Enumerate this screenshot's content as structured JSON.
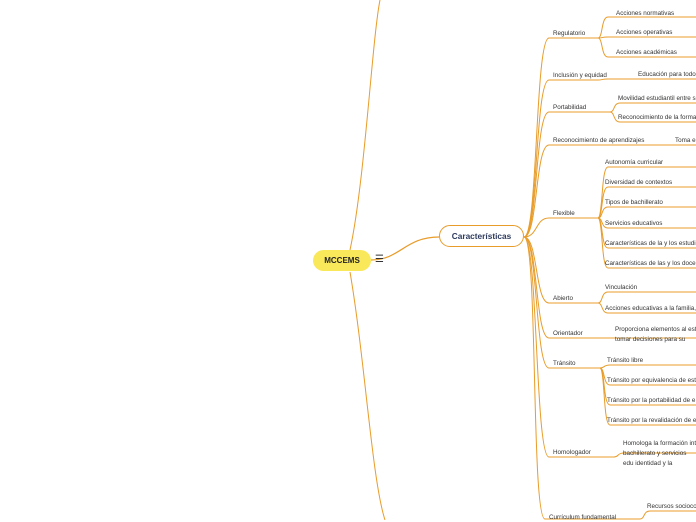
{
  "root": {
    "label": "MCCEMS",
    "icon": "menu-icon"
  },
  "main": {
    "label": "Características"
  },
  "colors": {
    "branch": "#e89c2a",
    "root_fill": "#f9e85a",
    "main_text": "#2d3a5c"
  },
  "categories": [
    {
      "label": "Regulatorio",
      "children": [
        "Acciones normativas",
        "Acciones operativas",
        "Acciones académicas"
      ]
    },
    {
      "label": "Inclusión y equidad",
      "children": [
        "Educación para todos"
      ]
    },
    {
      "label": "Portabilidad",
      "children": [
        "Movilidad estudiantil entre s",
        "Reconocimiento de la forma"
      ]
    },
    {
      "label": "Reconocimiento de aprendizajes",
      "children": [
        "Toma e"
      ]
    },
    {
      "label": "Flexible",
      "children": [
        "Autonomía curricular",
        "Diversidad de contextos",
        "Tipos de bachillerato",
        "Servicios educativos",
        "Características de la y los estudi",
        "Características de las y los docen"
      ]
    },
    {
      "label": "Abierto",
      "children": [
        "Vinculación",
        "Acciones educativas a la familia,"
      ]
    },
    {
      "label": "Orientador",
      "children": [
        "Proporciona elementos al est tomar decisiones para su futu"
      ]
    },
    {
      "label": "Tránsito",
      "children": [
        "Tránsito libre",
        "Tránsito por equivalencia de est",
        "Tránsito por la portabilidad de e",
        "Tránsito por la revalidación de e"
      ]
    },
    {
      "label": "Homologador",
      "children": [
        "Homologa la formación int bachillerato y servicios edu identidad y la diversidad"
      ]
    },
    {
      "label": "Currículum fundamental",
      "children": [
        "Recursos socioco"
      ]
    }
  ]
}
